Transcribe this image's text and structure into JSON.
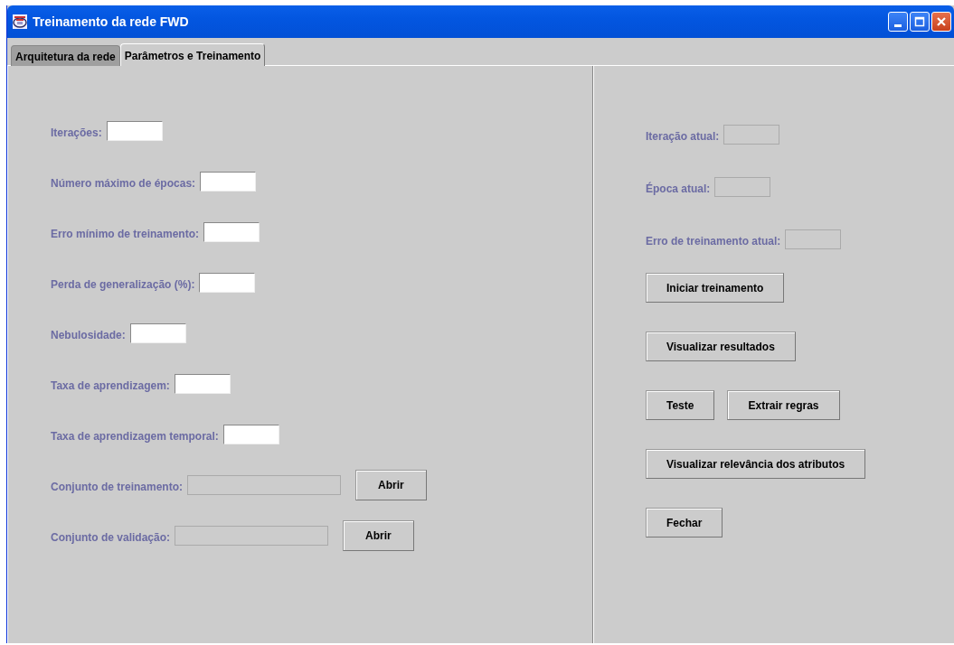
{
  "window": {
    "title": "Treinamento da rede FWD"
  },
  "tabs": [
    {
      "label": "Arquitetura da rede",
      "selected": false
    },
    {
      "label": "Parâmetros e Treinamento",
      "selected": true
    }
  ],
  "parameters": [
    {
      "kind": "text",
      "label": "Iterações:",
      "disabled": false
    },
    {
      "kind": "text",
      "label": "Número máximo de épocas:",
      "disabled": false
    },
    {
      "kind": "text",
      "label": "Erro mínimo de treinamento:",
      "disabled": false
    },
    {
      "kind": "text",
      "label": "Perda de generalização (%):",
      "disabled": false
    },
    {
      "kind": "text",
      "label": "Nebulosidade:",
      "disabled": false
    },
    {
      "kind": "text",
      "label": "Taxa de aprendizagem:",
      "disabled": false
    },
    {
      "kind": "text",
      "label": "Taxa de aprendizagem temporal:",
      "disabled": false
    },
    {
      "kind": "file",
      "label": "Conjunto de treinamento:",
      "disabled": true,
      "button": "Abrir"
    },
    {
      "kind": "file",
      "label": "Conjunto de validação:",
      "disabled": true,
      "button": "Abrir"
    }
  ],
  "progress": [
    {
      "label": "Iteração atual:",
      "disabled": true
    },
    {
      "label": "Época atual:",
      "disabled": true
    },
    {
      "label": "Erro de treinamento atual:",
      "disabled": true
    }
  ],
  "actions": [
    [
      "Iniciar treinamento"
    ],
    [
      "Visualizar resultados"
    ],
    [
      "Teste",
      "Extrair regras"
    ],
    [
      "Visualizar relevância dos atributos"
    ],
    [
      "Fechar"
    ]
  ]
}
